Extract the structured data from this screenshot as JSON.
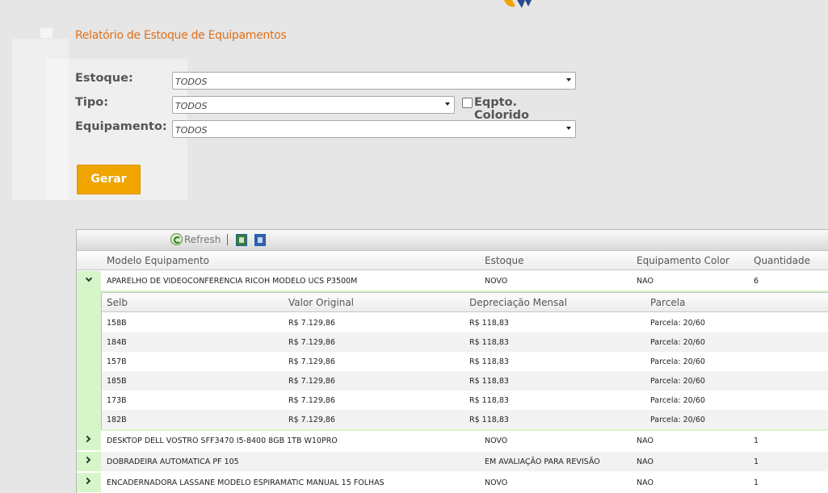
{
  "page": {
    "title": "Relatório de Estoque de Equipamentos"
  },
  "form": {
    "estoque_label": "Estoque:",
    "estoque_value": "TODOS",
    "tipo_label": "Tipo:",
    "tipo_value": "TODOS",
    "colorido_label": "Eqpto. Colorido",
    "colorido_checked": false,
    "equipamento_label": "Equipamento:",
    "equipamento_value": "TODOS",
    "submit_label": "Gerar"
  },
  "toolbar": {
    "refresh_label": "Refresh",
    "export_excel_icon": "excel-export-icon",
    "export_word_icon": "word-export-icon"
  },
  "grid": {
    "columns": [
      "Modelo Equipamento",
      "Estoque",
      "Equipamento Color",
      "Quantidade"
    ],
    "rows": [
      {
        "modelo": "APARELHO DE VIDEOCONFERENCIA RICOH MODELO UCS P3500M",
        "estoque": "NOVO",
        "color": "NAO",
        "quantidade": "6",
        "expanded": true
      },
      {
        "modelo": "DESKTOP DELL VOSTRO SFF3470 I5-8400 8GB 1TB W10PRO",
        "estoque": "NOVO",
        "color": "NAO",
        "quantidade": "1",
        "expanded": false
      },
      {
        "modelo": "DOBRADEIRA AUTOMATICA PF 105",
        "estoque": "EM AVALIAÇÃO PARA REVISÃO",
        "color": "NAO",
        "quantidade": "1",
        "expanded": false
      },
      {
        "modelo": "ENCADERNADORA LASSANE MODELO ESPIRAMATIC MANUAL 15 FOLHAS",
        "estoque": "NOVO",
        "color": "NAO",
        "quantidade": "1",
        "expanded": false
      }
    ],
    "detail": {
      "columns": [
        "Selb",
        "Valor Original",
        "Depreciação Mensal",
        "Parcela"
      ],
      "rows": [
        {
          "selb": "158B",
          "valor": "R$ 7.129,86",
          "depreciacao": "R$ 118,83",
          "parcela": "Parcela: 20/60"
        },
        {
          "selb": "184B",
          "valor": "R$ 7.129,86",
          "depreciacao": "R$ 118,83",
          "parcela": "Parcela: 20/60"
        },
        {
          "selb": "157B",
          "valor": "R$ 7.129,86",
          "depreciacao": "R$ 118,83",
          "parcela": "Parcela: 20/60"
        },
        {
          "selb": "185B",
          "valor": "R$ 7.129,86",
          "depreciacao": "R$ 118,83",
          "parcela": "Parcela: 20/60"
        },
        {
          "selb": "173B",
          "valor": "R$ 7.129,86",
          "depreciacao": "R$ 118,83",
          "parcela": "Parcela: 20/60"
        },
        {
          "selb": "182B",
          "valor": "R$ 7.129,86",
          "depreciacao": "R$ 118,83",
          "parcela": "Parcela: 20/60"
        }
      ]
    }
  },
  "colors": {
    "title": "#e0701a",
    "button": "#f0a500",
    "expander": "#d6f5c8"
  }
}
